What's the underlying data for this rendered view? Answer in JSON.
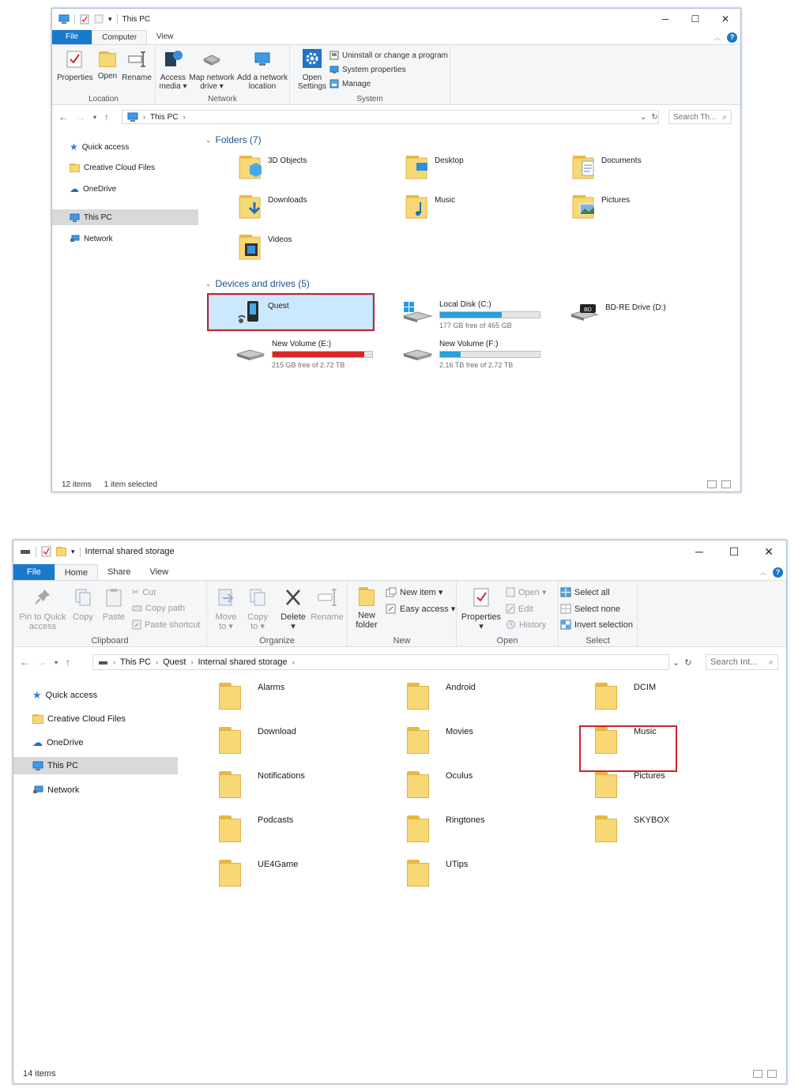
{
  "colors": {
    "accent": "#1979ca",
    "highlight": "#c9242b",
    "folder": "#f8d775",
    "drive_bar": "#26a0da",
    "drive_bar_full": "#da2626"
  },
  "window1": {
    "title": "This PC",
    "tabs": [
      {
        "label": "File"
      },
      {
        "label": "Computer"
      },
      {
        "label": "View"
      }
    ],
    "ribbon": {
      "location": {
        "label": "Location",
        "properties": "Properties",
        "open": "Open",
        "rename": "Rename"
      },
      "network": {
        "label": "Network",
        "access_media_1": "Access",
        "access_media_2": "media ▾",
        "map_drive_1": "Map network",
        "map_drive_2": "drive ▾",
        "add_location_1": "Add a network",
        "add_location_2": "location"
      },
      "system": {
        "label": "System",
        "open_settings_1": "Open",
        "open_settings_2": "Settings",
        "uninstall": "Uninstall or change a program",
        "system_properties": "System properties",
        "manage": "Manage"
      }
    },
    "address": {
      "crumb": "This PC"
    },
    "search": {
      "placeholder": "Search Th..."
    },
    "nav": [
      {
        "label": "Quick access"
      },
      {
        "label": "Creative Cloud Files"
      },
      {
        "label": "OneDrive"
      },
      {
        "label": "This PC"
      },
      {
        "label": "Network"
      }
    ],
    "folders_header": "Folders (7)",
    "folders": [
      {
        "label": "3D Objects"
      },
      {
        "label": "Desktop"
      },
      {
        "label": "Documents"
      },
      {
        "label": "Downloads"
      },
      {
        "label": "Music"
      },
      {
        "label": "Pictures"
      },
      {
        "label": "Videos"
      }
    ],
    "devices_header": "Devices and drives (5)",
    "devices": {
      "quest": "Quest",
      "c": {
        "name": "Local Disk (C:)",
        "free": "177 GB free of 465 GB",
        "used_fraction": 0.62
      },
      "d": {
        "name": "BD-RE Drive (D:)",
        "badge": "BD"
      },
      "e": {
        "name": "New Volume (E:)",
        "free": "215 GB free of 2.72 TB",
        "used_fraction": 0.92
      },
      "f": {
        "name": "New Volume (F:)",
        "free": "2.16 TB free of 2.72 TB",
        "used_fraction": 0.21
      }
    },
    "status": {
      "items": "12 items",
      "selected": "1 item selected"
    }
  },
  "window2": {
    "title": "Internal shared storage",
    "tabs": [
      {
        "label": "File"
      },
      {
        "label": "Home"
      },
      {
        "label": "Share"
      },
      {
        "label": "View"
      }
    ],
    "ribbon": {
      "clipboard": {
        "label": "Clipboard",
        "pin_1": "Pin to Quick",
        "pin_2": "access",
        "copy": "Copy",
        "paste": "Paste",
        "cut": "Cut",
        "copy_path": "Copy path",
        "paste_shortcut": "Paste shortcut"
      },
      "organize": {
        "label": "Organize",
        "move_1": "Move",
        "move_2": "to ▾",
        "copy_1": "Copy",
        "copy_2": "to ▾",
        "delete": "Delete",
        "delete_2": "▾",
        "rename": "Rename"
      },
      "new": {
        "label": "New",
        "new_folder_1": "New",
        "new_folder_2": "folder",
        "new_item": "New item ▾",
        "easy_access": "Easy access ▾"
      },
      "open": {
        "label": "Open",
        "properties": "Properties",
        "properties_2": "▾",
        "open": "Open ▾",
        "edit": "Edit",
        "history": "History"
      },
      "select": {
        "label": "Select",
        "select_all": "Select all",
        "select_none": "Select none",
        "invert": "Invert selection"
      }
    },
    "address": {
      "crumbs": [
        "This PC",
        "Quest",
        "Internal shared storage"
      ]
    },
    "search": {
      "placeholder": "Search Int..."
    },
    "nav": [
      {
        "label": "Quick access"
      },
      {
        "label": "Creative Cloud Files"
      },
      {
        "label": "OneDrive"
      },
      {
        "label": "This PC"
      },
      {
        "label": "Network"
      }
    ],
    "folders": [
      {
        "label": "Alarms"
      },
      {
        "label": "Android"
      },
      {
        "label": "DCIM"
      },
      {
        "label": "Download"
      },
      {
        "label": "Movies"
      },
      {
        "label": "Music"
      },
      {
        "label": "Notifications"
      },
      {
        "label": "Oculus"
      },
      {
        "label": "Pictures"
      },
      {
        "label": "Podcasts"
      },
      {
        "label": "Ringtones"
      },
      {
        "label": "SKYBOX"
      },
      {
        "label": "UE4Game"
      },
      {
        "label": "UTips"
      }
    ],
    "status": {
      "items": "14 items"
    }
  }
}
